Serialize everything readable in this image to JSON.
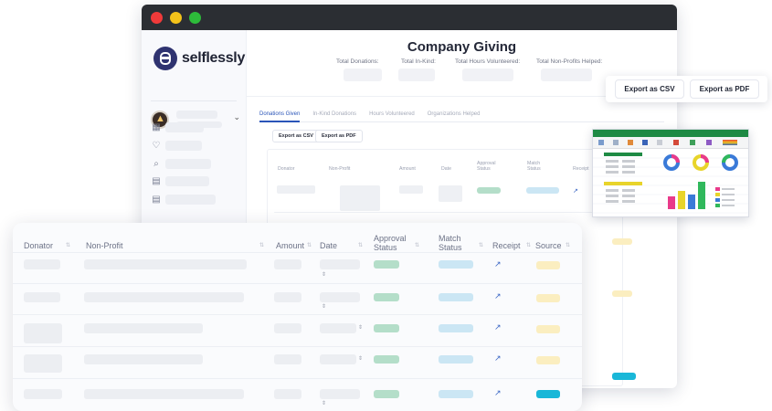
{
  "app": {
    "brand": "selflessly",
    "page_title": "Company Giving"
  },
  "stats": [
    "Total Donations:",
    "Total In-Kind:",
    "Total Hours Volunteered:",
    "Total Non-Profits Helped:"
  ],
  "tabs": [
    "Donations Given",
    "In-Kind Donations",
    "Hours Volunteered",
    "Organizations Helped"
  ],
  "toolbar": {
    "export_csv": "Export as CSV",
    "export_pdf": "Export as PDF"
  },
  "table": {
    "headers": [
      "Donator",
      "Non-Profit",
      "Amount",
      "Date",
      "Approval Status",
      "Match Status",
      "Receipt"
    ]
  },
  "export_popup": {
    "csv": "Export as CSV",
    "pdf": "Export as PDF"
  },
  "zoom_table": {
    "headers": [
      "Donator",
      "Non-Profit",
      "Amount",
      "Date",
      "Approval Status",
      "Match Status",
      "Receipt",
      "Source"
    ]
  },
  "colors": {
    "accent": "#2a55b8",
    "approved": "#b4dec9",
    "match": "#cbe6f4",
    "source": "#fbeec0",
    "source_active": "#19b7d8",
    "brand": "#2f3370"
  },
  "icons": [
    "grid-icon",
    "heart-icon",
    "search-icon",
    "calendar-icon",
    "external-link-icon"
  ]
}
